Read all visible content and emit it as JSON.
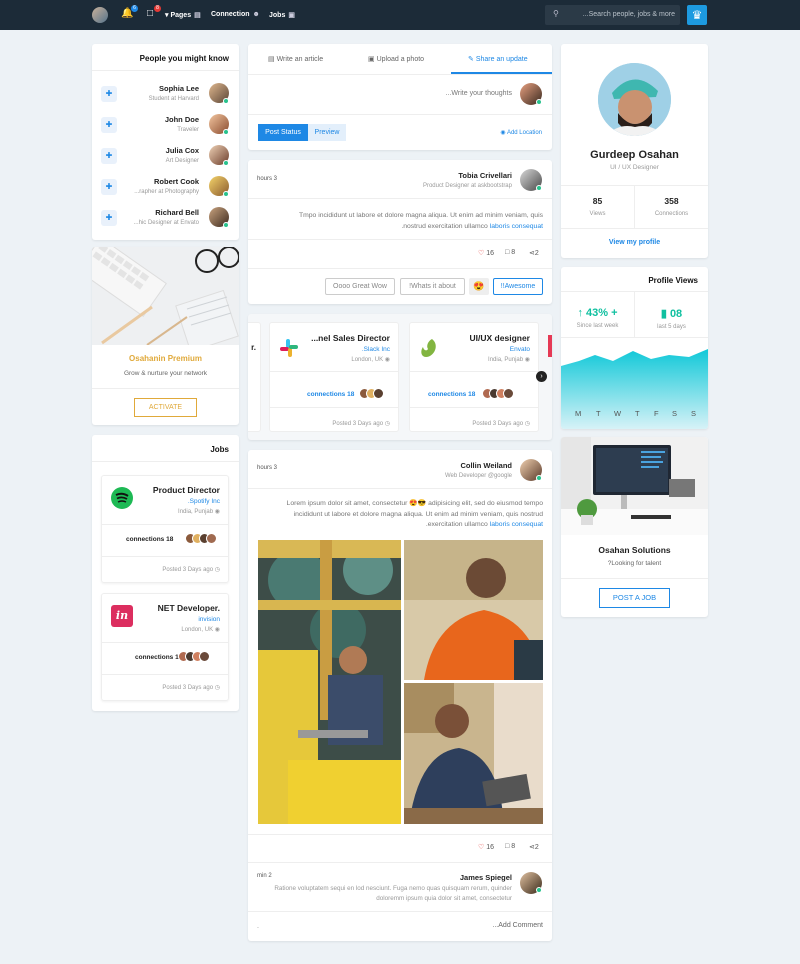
{
  "nav": {
    "notif_count": "6",
    "msg_count": "8",
    "pages": "Pages",
    "connection": "Connection",
    "jobs": "Jobs",
    "search_placeholder": "...Search people, jobs & more"
  },
  "people": {
    "title": "People you might know",
    "items": [
      {
        "name": "Sophia Lee",
        "role": "Student at Harvard"
      },
      {
        "name": "John Doe",
        "role": "Traveler"
      },
      {
        "name": "Julia Cox",
        "role": "Art Designer"
      },
      {
        "name": "Robert Cook",
        "role": "...rapher at Photography"
      },
      {
        "name": "Richard Bell",
        "role": "...hic Designer at Envato"
      }
    ]
  },
  "premium": {
    "title": "Osahanin Premium",
    "subtitle": "Grow & nurture your network",
    "button": "ACTIVATE"
  },
  "jobs": {
    "title": "Jobs",
    "items": [
      {
        "title": "Product Director",
        "company": ".Spotify Inc",
        "location": "India, Punjab",
        "connections": "connections 18",
        "posted": "Posted 3 Days ago"
      },
      {
        "title": "NET Developer.",
        "company": "invision",
        "location": "London, UK",
        "connections": "connections 18",
        "posted": "Posted 3 Days ago"
      }
    ]
  },
  "composer": {
    "tabs": [
      "Write an article",
      "Upload a photo",
      "Share an update"
    ],
    "placeholder": "...Write your thoughts",
    "post_status": "Post Status",
    "preview": "Preview",
    "add_location": "Add Location"
  },
  "post1": {
    "author": "Tobia Crivellari",
    "role": "Product Designer at askbootstrap",
    "time": "hours 3",
    "text1": "Tmpo incididunt ut labore et dolore magna aliqua. Ut enim ad minim veniam, quis",
    "text2": ".nostrud exercitation ullamco",
    "text_link": "laboris consequat",
    "likes": "16",
    "comments": "8",
    "shares": "2",
    "replies": [
      "Oooo Great Wow",
      "!Whats it about",
      "!!Awesome"
    ]
  },
  "carousel": [
    {
      "title": "...nel Sales Director",
      "company": ".Slack Inc",
      "location": "London, UK",
      "connections": "connections 18",
      "posted": "Posted 3 Days ago"
    },
    {
      "title": "UI/UX designer",
      "company": "Envato",
      "location": "India, Punjab",
      "connections": "connections 18",
      "posted": "Posted 3 Days ago"
    }
  ],
  "post2": {
    "author": "Collin Weiland",
    "role": "Web Developer @google",
    "time": "hours 3",
    "line1": "Lorem ipsum dolor sit amet, consectetur 😍😎 adipisicing elit, sed do eiusmod tempo",
    "line2": "incididunt ut labore et dolore magna aliqua. Ut enim ad minim veniam, quis nostrud",
    "line3": ".exercitation ullamco",
    "link": "laboris consequat",
    "likes": "16",
    "comments": "8",
    "shares": "2"
  },
  "comment": {
    "author": "James Spiegel",
    "time": "min 2",
    "text1": "Ratione voluptatem sequi en lod nesciunt. Fuga nemo quas quisquam rerum, quinder",
    "text2": "doloremm ipsum quia dolor sit amet, consectetur",
    "add_comment": "...Add Comment",
    "dot": "."
  },
  "profile": {
    "name": "Gurdeep Osahan",
    "role": "UI / UX Designer",
    "views": "85",
    "views_label": "Views",
    "connections": "358",
    "connections_label": "Connections",
    "link": "View my profile"
  },
  "profile_views": {
    "title": "Profile Views",
    "stat1": "43% +",
    "stat1_label": "Since last week",
    "stat2": "08",
    "stat2_label": "last 5 days",
    "days": [
      "M",
      "T",
      "W",
      "T",
      "F",
      "S",
      "S"
    ]
  },
  "company": {
    "name": "Osahan Solutions",
    "tagline": "?Looking for talent",
    "button": "POST A JOB"
  },
  "colors": {
    "accent": "#1e88e5",
    "gold": "#e0a93a",
    "teal": "#10c0a0",
    "nav": "#1c2b38"
  }
}
